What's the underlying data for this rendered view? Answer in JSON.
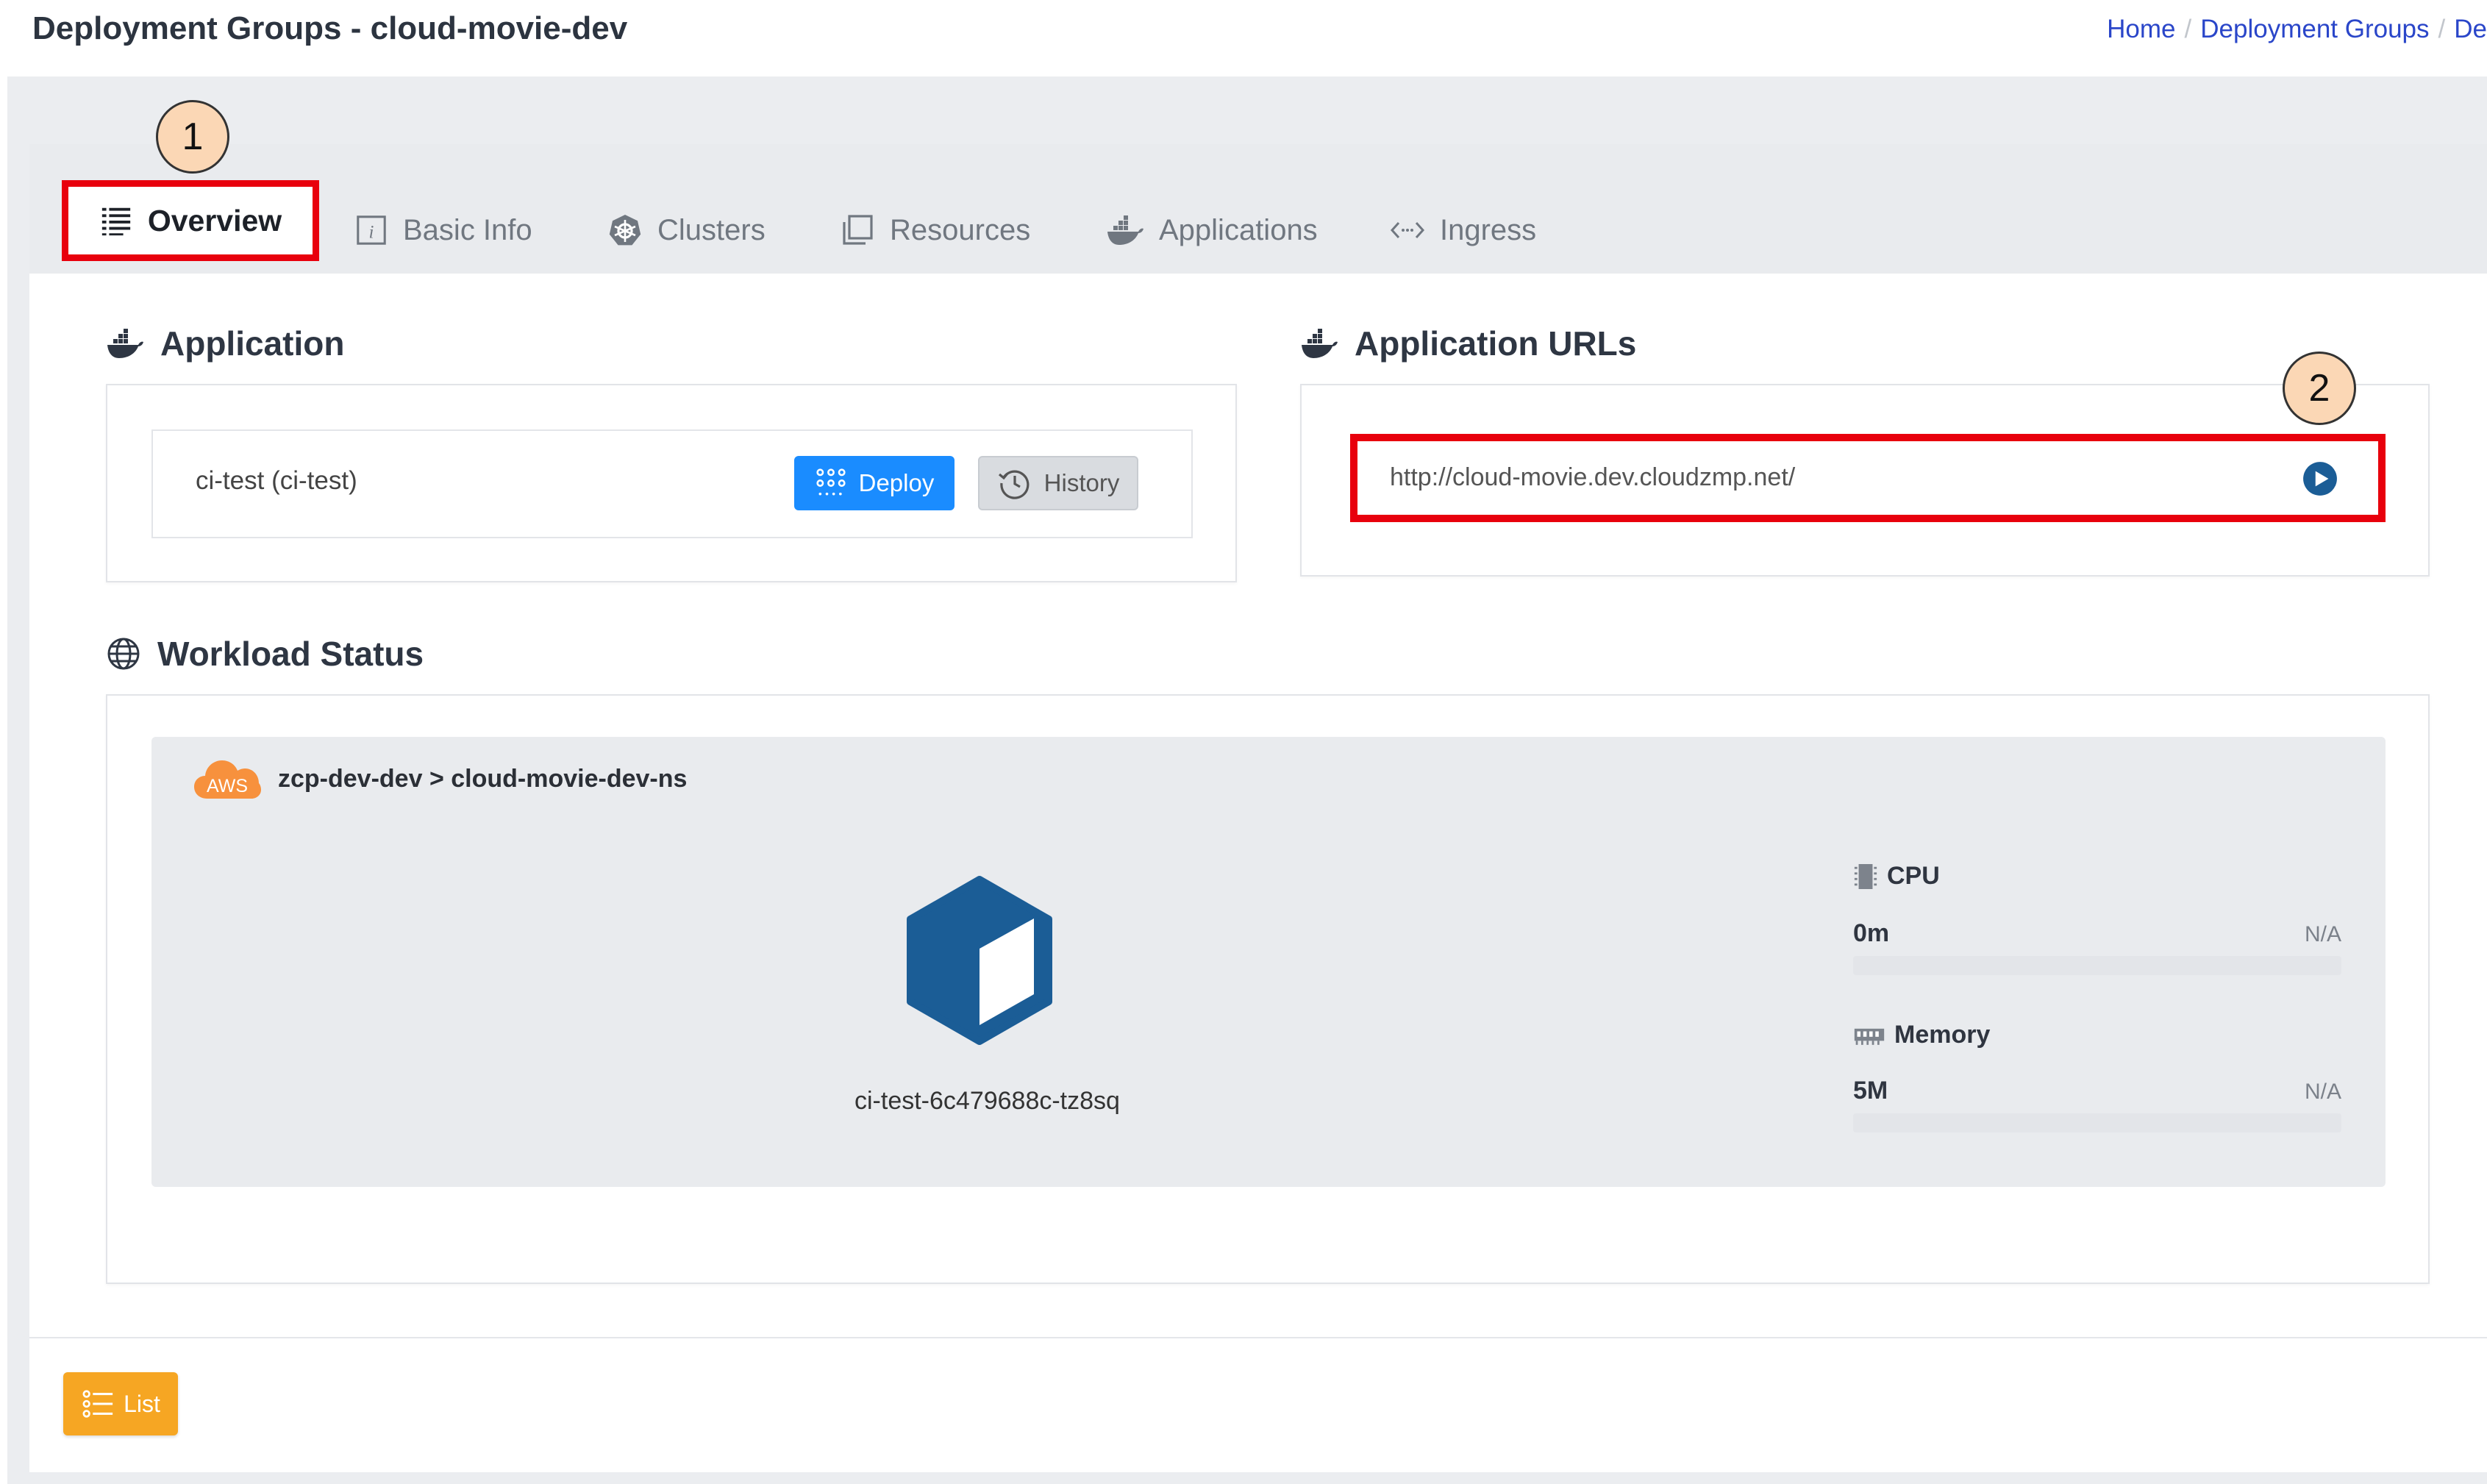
{
  "header": {
    "title": "Deployment Groups - cloud-movie-dev",
    "breadcrumb": [
      "Home",
      "Deployment Groups",
      "De"
    ]
  },
  "tabs": {
    "overview": "Overview",
    "basic_info": "Basic Info",
    "clusters": "Clusters",
    "resources": "Resources",
    "applications": "Applications",
    "ingress": "Ingress"
  },
  "markers": {
    "one": "1",
    "two": "2"
  },
  "application": {
    "heading": "Application",
    "name": "ci-test (ci-test)",
    "deploy_label": "Deploy",
    "history_label": "History"
  },
  "application_urls": {
    "heading": "Application URLs",
    "url": "http://cloud-movie.dev.cloudzmp.net/"
  },
  "workload": {
    "heading": "Workload Status",
    "provider_badge": "AWS",
    "namespace_path": "zcp-dev-dev > cloud-movie-dev-ns",
    "pod_name": "ci-test-6c479688c-tz8sq",
    "cpu": {
      "label": "CPU",
      "value": "0m",
      "limit": "N/A"
    },
    "memory": {
      "label": "Memory",
      "value": "5M",
      "limit": "N/A"
    }
  },
  "footer": {
    "list_label": "List"
  },
  "colors": {
    "primary_blue": "#1a8cff",
    "highlight_red": "#e8000d",
    "marker_fill": "#fbd7b5",
    "list_orange": "#f6a623",
    "pod_icon": "#1b5d96",
    "aws_orange": "#f7913d"
  }
}
